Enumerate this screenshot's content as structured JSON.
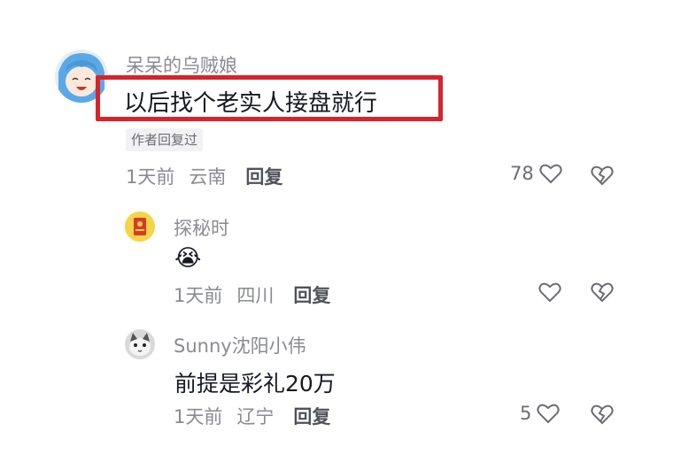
{
  "comments": [
    {
      "username": "呆呆的乌贼娘",
      "text": "以后找个老实人接盘就行",
      "badge": "作者回复过",
      "time": "1天前",
      "location": "云南",
      "reply": "回复",
      "likes": "78"
    },
    {
      "username": "探秘时",
      "emoji": "😭",
      "time": "1天前",
      "location": "四川",
      "reply": "回复",
      "likes": ""
    },
    {
      "username": "Sunny沈阳小伟",
      "text": "前提是彩礼20万",
      "time": "1天前",
      "location": "辽宁",
      "reply": "回复",
      "likes": "5"
    }
  ],
  "colors": {
    "highlight": "#d8232a",
    "muted": "#8a8b91",
    "text": "#161823"
  },
  "icons": [
    "heart-icon",
    "broken-heart-icon"
  ]
}
